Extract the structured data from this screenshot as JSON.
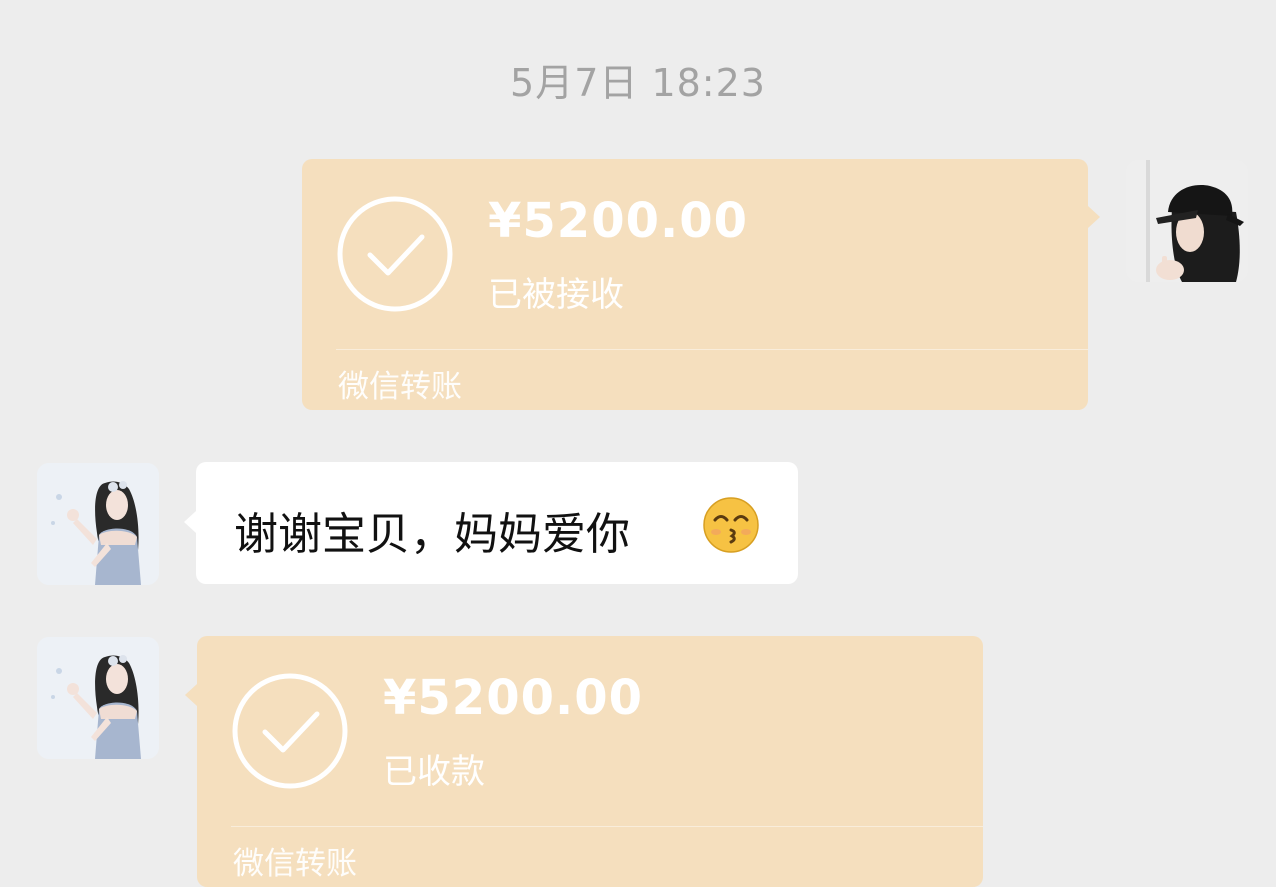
{
  "chat": {
    "timestamp": "5月7日 18:23",
    "messages": [
      {
        "type": "transfer",
        "direction": "outgoing",
        "amount": "¥5200.00",
        "status": "已被接收",
        "footer": "微信转账"
      },
      {
        "type": "text",
        "direction": "incoming",
        "text": "谢谢宝贝，妈妈爱你",
        "emoji": "kissing-face-with-smiling-eyes"
      },
      {
        "type": "transfer",
        "direction": "incoming",
        "amount": "¥5200.00",
        "status": "已收款",
        "footer": "微信转账"
      }
    ]
  },
  "icons": {
    "transfer_status": "check-circle-icon",
    "self_avatar": "avatar-person-black-cap",
    "contact_avatar": "avatar-woman-portrait"
  },
  "colors": {
    "background": "#ededed",
    "transfer_bubble": "#f5dfbe",
    "text_bubble": "#ffffff",
    "timestamp": "#a3a3a3"
  }
}
